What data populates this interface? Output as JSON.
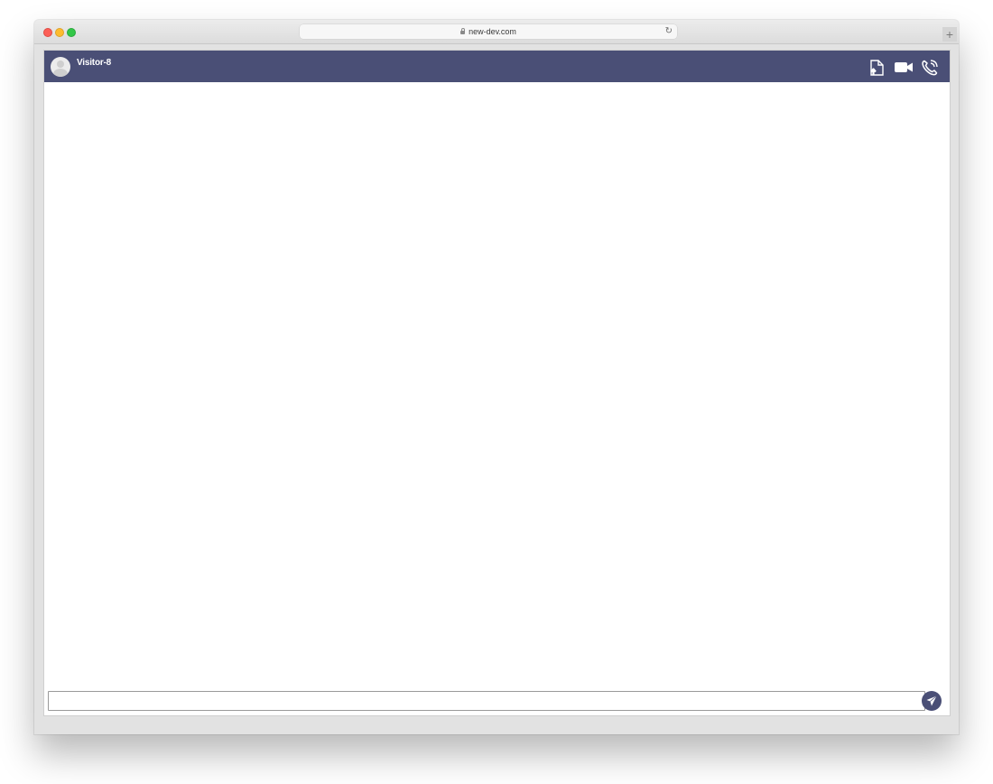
{
  "browser": {
    "url": "new-dev.com",
    "new_tab_label": "+"
  },
  "chat": {
    "visitor_name": "Visitor-8",
    "header_icons": [
      "file-upload-icon",
      "video-call-icon",
      "phone-call-icon"
    ],
    "message_input": {
      "value": "",
      "placeholder": ""
    },
    "send_icon": "paper-plane-icon"
  },
  "colors": {
    "header_bg": "#4a4f76",
    "send_button_bg": "#4a4f76",
    "header_text": "#ffffff",
    "window_chrome": "#e2e2e2"
  }
}
